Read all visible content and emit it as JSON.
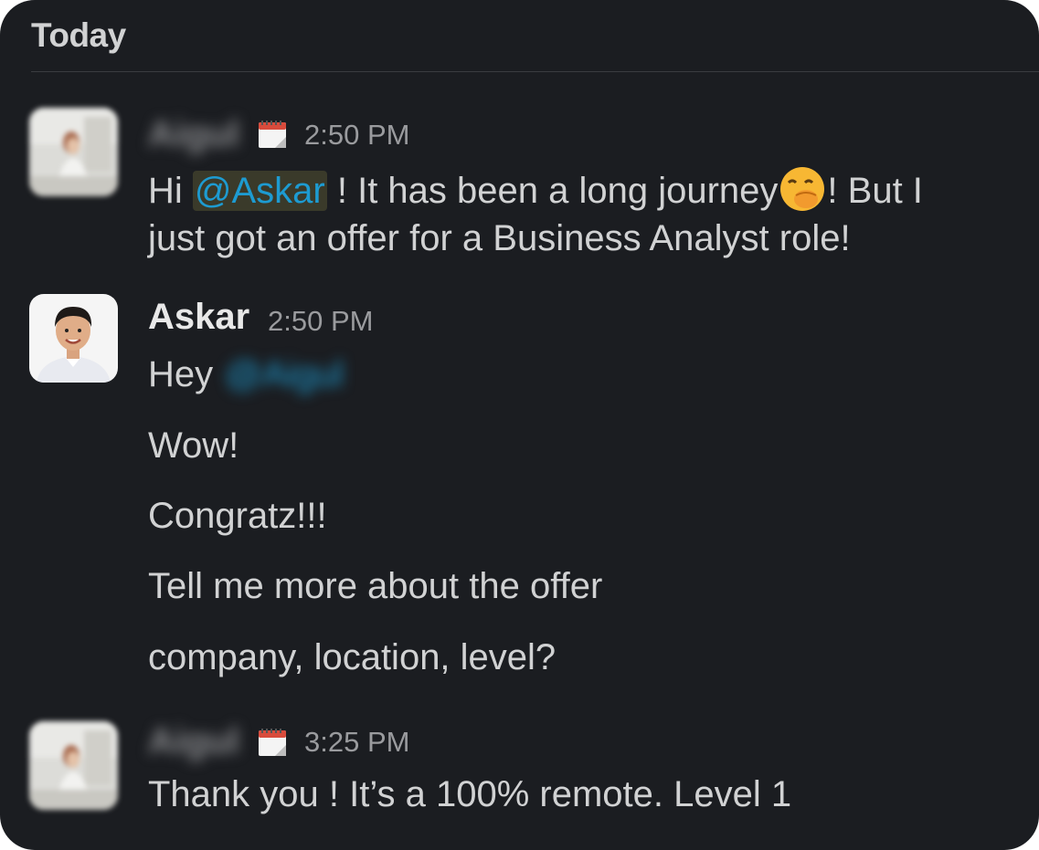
{
  "header": {
    "day_label": "Today"
  },
  "messages": [
    {
      "sender": "Aigul",
      "status_icon": "calendar-icon",
      "time": "2:50 PM",
      "line1_pre": "Hi ",
      "mention": "@Askar",
      "line1_mid": " ! It has been a long journey",
      "emoji": "face-with-hand-over-mouth",
      "line1_post": "! But I",
      "line2": "just got an offer for a Business Analyst role!"
    },
    {
      "sender": "Askar",
      "time": "2:50 PM",
      "lines": {
        "hey": "Hey ",
        "hey_mention": "@Aigul",
        "wow": "Wow!",
        "congratz": "Congratz!!!",
        "tell": "Tell me more about the offer",
        "company": "company, location, level?"
      }
    },
    {
      "sender": "Aigul",
      "status_icon": "calendar-icon",
      "time": "3:25 PM",
      "line1": "Thank you ! It’s a 100% remote. Level 1"
    }
  ],
  "colors": {
    "background": "#1b1d21",
    "text": "#d1d2d3",
    "mention": "#1d9bd1",
    "timestamp": "#9a9b9e"
  }
}
